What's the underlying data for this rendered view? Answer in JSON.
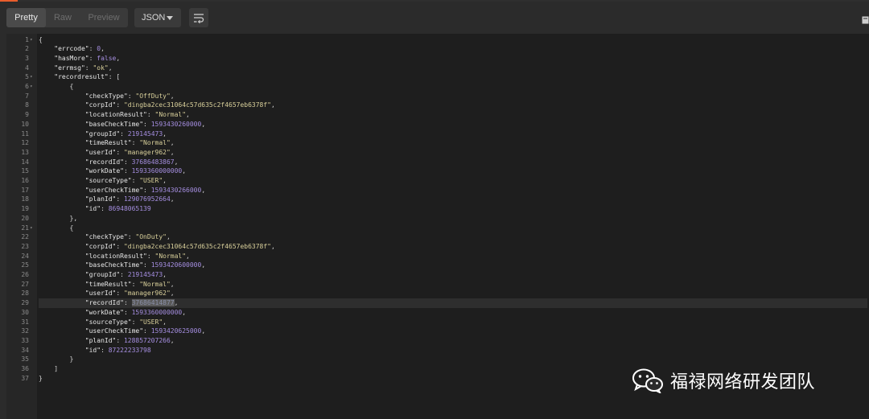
{
  "toolbar": {
    "view_modes": [
      "Pretty",
      "Raw",
      "Preview"
    ],
    "active_mode": "Pretty",
    "format": "JSON"
  },
  "colors": {
    "key": "#e6e6e6",
    "string": "#d8cf9a",
    "number": "#a58ee0",
    "accent": "#e85c2c"
  },
  "icons": [
    "chevron-down-icon",
    "wrap-lines-icon",
    "document-icon",
    "wechat-icon"
  ],
  "editor": {
    "folded_lines": [
      1,
      5,
      6,
      21
    ],
    "selected_line": 29,
    "lines": [
      "{",
      "    \"errcode\": 0,",
      "    \"hasMore\": false,",
      "    \"errmsg\": \"ok\",",
      "    \"recordresult\": [",
      "        {",
      "            \"checkType\": \"OffDuty\",",
      "            \"corpId\": \"dingba2cec31064c57d635c2f4657eb6378f\",",
      "            \"locationResult\": \"Normal\",",
      "            \"baseCheckTime\": 1593430260000,",
      "            \"groupId\": 219145473,",
      "            \"timeResult\": \"Normal\",",
      "            \"userId\": \"manager962\",",
      "            \"recordId\": 37686483867,",
      "            \"workDate\": 1593360000000,",
      "            \"sourceType\": \"USER\",",
      "            \"userCheckTime\": 1593430266000,",
      "            \"planId\": 129076952664,",
      "            \"id\": 86948065139",
      "        },",
      "        {",
      "            \"checkType\": \"OnDuty\",",
      "            \"corpId\": \"dingba2cec31064c57d635c2f4657eb6378f\",",
      "            \"locationResult\": \"Normal\",",
      "            \"baseCheckTime\": 1593420600000,",
      "            \"groupId\": 219145473,",
      "            \"timeResult\": \"Normal\",",
      "            \"userId\": \"manager962\",",
      "            \"recordId\": 37686414877,",
      "            \"workDate\": 1593360000000,",
      "            \"sourceType\": \"USER\",",
      "            \"userCheckTime\": 1593420625000,",
      "            \"planId\": 128857207266,",
      "            \"id\": 87222233798",
      "        }",
      "    ]",
      "}"
    ]
  },
  "watermark": {
    "text": "福禄网络研发团队"
  }
}
